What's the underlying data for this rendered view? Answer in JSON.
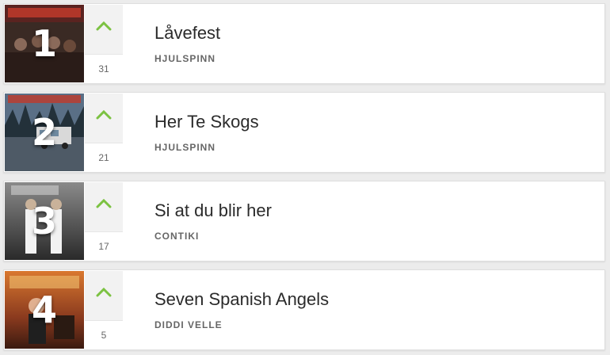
{
  "chart": {
    "entries": [
      {
        "rank": "1",
        "title": "Låvefest",
        "artist": "HJULSPINN",
        "weeks": "31",
        "trend": "up",
        "trend_color": "#7cc242",
        "cover_theme": "band-photo-dark-red"
      },
      {
        "rank": "2",
        "title": "Her Te Skogs",
        "artist": "HJULSPINN",
        "weeks": "21",
        "trend": "up",
        "trend_color": "#7cc242",
        "cover_theme": "forest-van-blue"
      },
      {
        "rank": "3",
        "title": "Si at du blir her",
        "artist": "CONTIKI",
        "weeks": "17",
        "trend": "up",
        "trend_color": "#7cc242",
        "cover_theme": "duo-grey-gradient"
      },
      {
        "rank": "4",
        "title": "Seven Spanish Angels",
        "artist": "DIDDI VELLE",
        "weeks": "5",
        "trend": "up",
        "trend_color": "#7cc242",
        "cover_theme": "western-orange-sky"
      }
    ]
  }
}
